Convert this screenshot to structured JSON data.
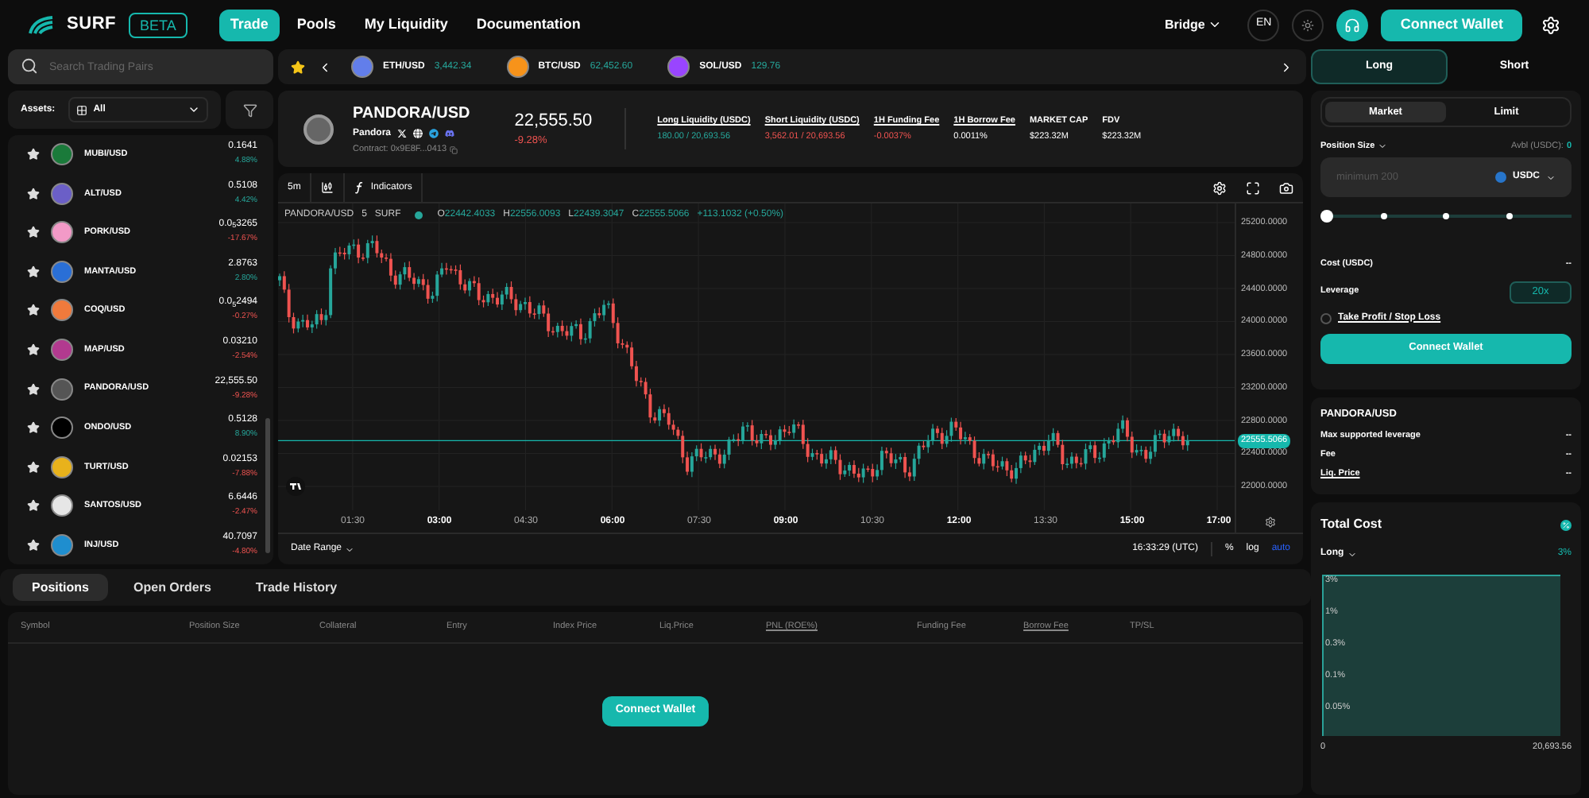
{
  "header": {
    "logo": "SURF",
    "badge": "BETA",
    "bridge": "Bridge",
    "language": "EN",
    "connect": "Connect Wallet"
  },
  "nav": [
    {
      "label": "Trade",
      "selected": true
    },
    {
      "label": "Pools",
      "selected": false
    },
    {
      "label": "My Liquidity",
      "selected": false
    },
    {
      "label": "Documentation",
      "selected": false
    }
  ],
  "search": {
    "placeholder": "Search Trading Pairs"
  },
  "ticker": [
    {
      "pair": "ETH/USD",
      "price": "3,442.34",
      "color": "#627eea"
    },
    {
      "pair": "BTC/USD",
      "price": "62,452.60",
      "color": "#f7931a"
    },
    {
      "pair": "SOL/USD",
      "price": "129.76",
      "color": "#9945ff"
    }
  ],
  "side_tabs": [
    {
      "label": "Long",
      "selected": true
    },
    {
      "label": "Short",
      "selected": false
    }
  ],
  "assets_filter": {
    "label": "Assets:",
    "value": "All"
  },
  "assets": [
    {
      "pair": "MUBI/USD",
      "price": "0.1641",
      "change": "4.88%",
      "negative": false,
      "color": "#1a7a3a"
    },
    {
      "pair": "ALT/USD",
      "price": "0.5108",
      "change": "4.42%",
      "negative": false,
      "color": "#6b5fc7"
    },
    {
      "pair": "PORK/USD",
      "price": "0.0$_{5}$3265",
      "change": "-17.67%",
      "negative": true,
      "color": "#f29ac7"
    },
    {
      "pair": "MANTA/USD",
      "price": "2.8763",
      "change": "2.80%",
      "negative": false,
      "color": "#2a6fd6"
    },
    {
      "pair": "COQ/USD",
      "price": "0.0$_{5}$2494",
      "change": "-0.27%",
      "negative": true,
      "color": "#f07a3c"
    },
    {
      "pair": "MAP/USD",
      "price": "0.03210",
      "change": "-2.54%",
      "negative": true,
      "color": "#b23a8f"
    },
    {
      "pair": "PANDORA/USD",
      "price": "22,555.50",
      "change": "-9.28%",
      "negative": true,
      "color": "#555555"
    },
    {
      "pair": "ONDO/USD",
      "price": "0.5128",
      "change": "8.90%",
      "negative": false,
      "color": "#000000"
    },
    {
      "pair": "TURT/USD",
      "price": "0.02153",
      "change": "-7.88%",
      "negative": true,
      "color": "#e8b21c"
    },
    {
      "pair": "SANTOS/USD",
      "price": "6.6446",
      "change": "-2.47%",
      "negative": true,
      "color": "#e6e6e6"
    },
    {
      "pair": "INJ/USD",
      "price": "40.7097",
      "change": "-4.80%",
      "negative": true,
      "color": "#1f8ecf"
    }
  ],
  "pair_header": {
    "pair": "PANDORA/USD",
    "name": "Pandora",
    "contract": "Contract: 0x9E8F...0413",
    "price": "22,555.50",
    "change": "-9.28%",
    "negative": true
  },
  "stats": [
    {
      "label": "Long Liquidity (USDC)",
      "value": "180.00 / 20,693.56",
      "color": "#26a69a",
      "underlined": true
    },
    {
      "label": "Short Liquidity (USDC)",
      "value": "3,562.01 / 20,693.56",
      "color": "#ef5350",
      "underlined": true
    },
    {
      "label": "1H Funding Fee",
      "value": "-0.0037%",
      "color": "#ef5350",
      "underlined": true
    },
    {
      "label": "1H Borrow Fee",
      "value": "0.0011%",
      "color": "#ffffff",
      "underlined": true
    },
    {
      "label": "MARKET CAP",
      "value": "$223.32M",
      "color": "#ffffff",
      "underlined": false
    },
    {
      "label": "FDV",
      "value": "$223.32M",
      "color": "#ffffff",
      "underlined": false
    }
  ],
  "chart_toolbar": {
    "interval": "5m",
    "indicators": "Indicators"
  },
  "legend": {
    "symbol": "PANDORA/USD",
    "interval": "5",
    "source": "SURF",
    "ohlc": [
      {
        "key": "O",
        "value": "22442.4033"
      },
      {
        "key": "H",
        "value": "22556.0093"
      },
      {
        "key": "L",
        "value": "22439.3047"
      },
      {
        "key": "C",
        "value": "22555.5066"
      }
    ],
    "delta": "+113.1032 (+0.50%)"
  },
  "price_axis": [
    "25200.0000",
    "24800.0000",
    "24400.0000",
    "24000.0000",
    "23600.0000",
    "23200.0000",
    "22800.0000",
    "22400.0000",
    "22000.0000"
  ],
  "current_price": "22555.5066",
  "time_axis": [
    {
      "label": "01:30",
      "major": false
    },
    {
      "label": "03:00",
      "major": true
    },
    {
      "label": "04:30",
      "major": false
    },
    {
      "label": "06:00",
      "major": true
    },
    {
      "label": "07:30",
      "major": false
    },
    {
      "label": "09:00",
      "major": true
    },
    {
      "label": "10:30",
      "major": false
    },
    {
      "label": "12:00",
      "major": true
    },
    {
      "label": "13:30",
      "major": false
    },
    {
      "label": "15:00",
      "major": true
    },
    {
      "label": "17:00",
      "major": true
    }
  ],
  "chart_footer": {
    "date_range": "Date Range",
    "clock": "16:33:29 (UTC)",
    "scales": [
      {
        "label": "%",
        "selected": false
      },
      {
        "label": "log",
        "selected": false
      },
      {
        "label": "auto",
        "selected": true
      }
    ]
  },
  "bottom_tabs": [
    {
      "label": "Positions",
      "selected": true
    },
    {
      "label": "Open Orders",
      "selected": false
    },
    {
      "label": "Trade History",
      "selected": false
    }
  ],
  "columns": [
    {
      "label": "Symbol",
      "underlined": false
    },
    {
      "label": "Position Size",
      "underlined": false
    },
    {
      "label": "Collateral",
      "underlined": false
    },
    {
      "label": "Entry",
      "underlined": false
    },
    {
      "label": "Index Price",
      "underlined": false
    },
    {
      "label": "Liq.Price",
      "underlined": false
    },
    {
      "label": "PNL (ROE%)",
      "underlined": true
    },
    {
      "label": "Funding Fee",
      "underlined": false
    },
    {
      "label": "Borrow Fee",
      "underlined": true
    },
    {
      "label": "TP/SL",
      "underlined": false
    }
  ],
  "positions_button": "Connect Wallet",
  "order_types": [
    {
      "label": "Market",
      "selected": true
    },
    {
      "label": "Limit",
      "selected": false
    }
  ],
  "order": {
    "size_label": "Position Size",
    "available_label": "Avbl (USDC):",
    "available": "0",
    "placeholder": "minimum 200",
    "token": "USDC",
    "level": 0,
    "cost_label": "Cost (USDC)",
    "cost": "--",
    "leverage_label": "Leverage",
    "leverage": "20x",
    "tpsl": "Take Profit / Stop Loss",
    "tpsl_checked": false,
    "button": "Connect Wallet"
  },
  "info": {
    "title": "PANDORA/USD",
    "rows": [
      {
        "label": "Max supported leverage",
        "value": "--",
        "underlined": false
      },
      {
        "label": "Fee",
        "value": "--",
        "underlined": false
      },
      {
        "label": "Liq. Price",
        "value": "--",
        "underlined": true
      }
    ]
  },
  "total_cost": {
    "title": "Total Cost",
    "toggle_on": true,
    "side": "Long",
    "percent": "3%",
    "y_labels": [
      "3%",
      "1%",
      "0.3%",
      "0.1%",
      "0.05%"
    ],
    "x_min": "0",
    "x_max": "20,693.56"
  }
}
